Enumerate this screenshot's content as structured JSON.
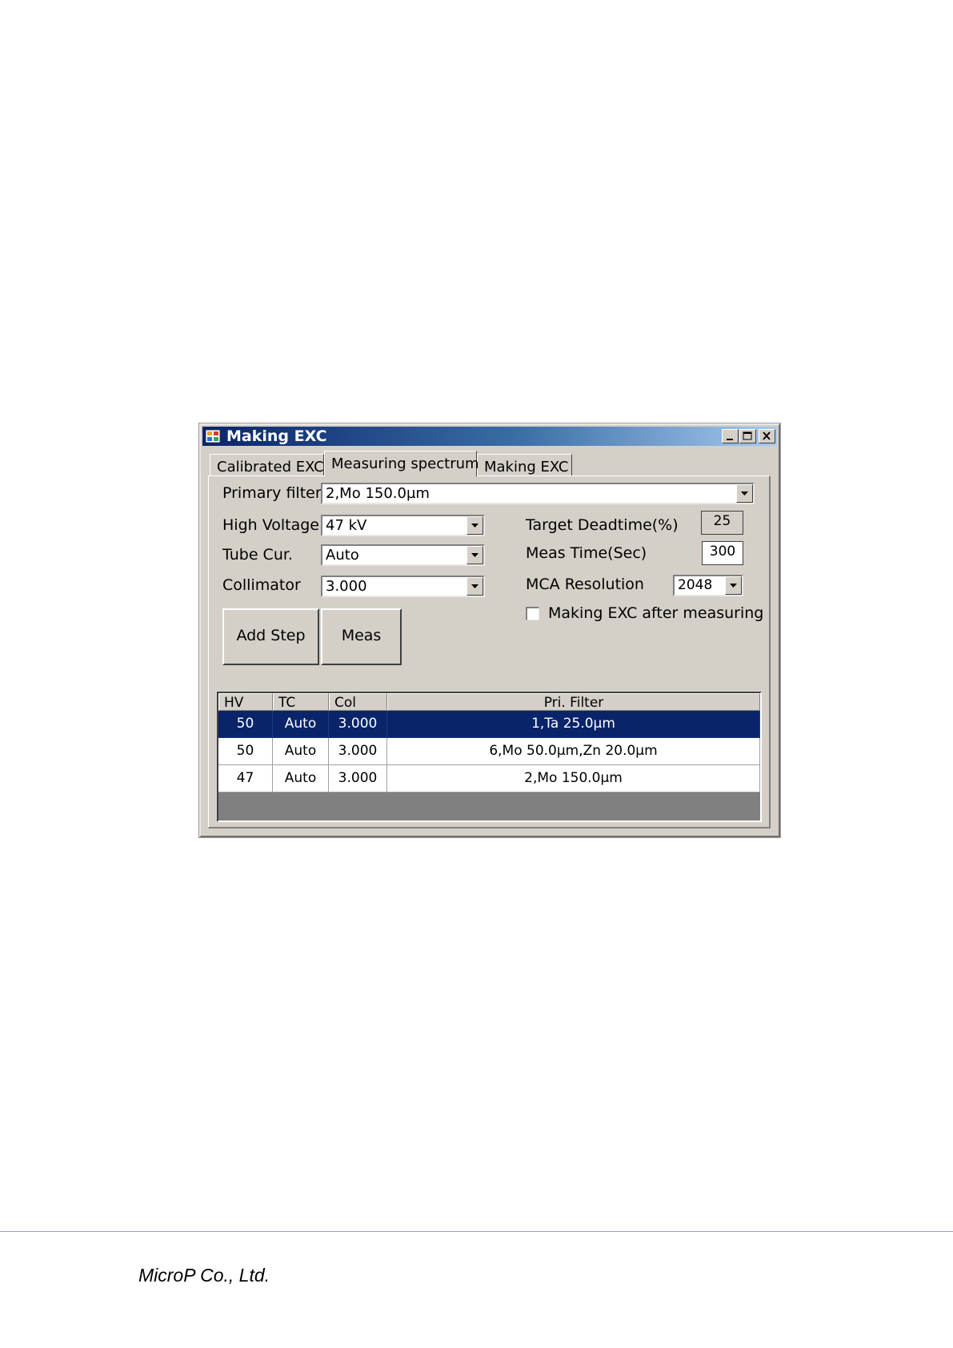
{
  "window": {
    "title": "Making EXC",
    "controls": [
      "minimize-icon",
      "maximize-icon",
      "close-icon"
    ]
  },
  "tabs": [
    {
      "label": "Calibrated EXC",
      "active": false
    },
    {
      "label": "Measuring spectrum",
      "active": true
    },
    {
      "label": "Making EXC",
      "active": false
    }
  ],
  "form": {
    "primary_filter": {
      "label": "Primary filter",
      "value": "2,Mo 150.0µm"
    },
    "high_voltage": {
      "label": "High Voltage",
      "value": "47 kV"
    },
    "tube_cur": {
      "label": "Tube Cur.",
      "value": "Auto"
    },
    "collimator": {
      "label": "Collimator",
      "value": "3.000"
    },
    "target_deadtime": {
      "label": "Target Deadtime(%)",
      "value": "25"
    },
    "meas_time": {
      "label": "Meas Time(Sec)",
      "value": "300"
    },
    "mca_resolution": {
      "label": "MCA Resolution",
      "value": "2048"
    },
    "making_exc_checkbox": {
      "label": "Making EXC after measuring",
      "checked": false
    }
  },
  "buttons": {
    "add_step": "Add Step",
    "meas": "Meas"
  },
  "grid": {
    "columns": [
      "HV",
      "TC",
      "Col",
      "Pri. Filter"
    ],
    "rows": [
      {
        "hv": "50",
        "tc": "Auto",
        "col": "3.000",
        "filter": "1,Ta 25.0µm",
        "selected": true
      },
      {
        "hv": "50",
        "tc": "Auto",
        "col": "3.000",
        "filter": "6,Mo 50.0µm,Zn 20.0µm",
        "selected": false
      },
      {
        "hv": "47",
        "tc": "Auto",
        "col": "3.000",
        "filter": "2,Mo 150.0µm",
        "selected": false
      }
    ]
  },
  "footer": {
    "company": "MicroP Co., Ltd."
  },
  "colors": {
    "face": "#d4d0c8",
    "title_start": "#0a246a",
    "title_end": "#a6caf0",
    "selection": "#0a246a"
  }
}
